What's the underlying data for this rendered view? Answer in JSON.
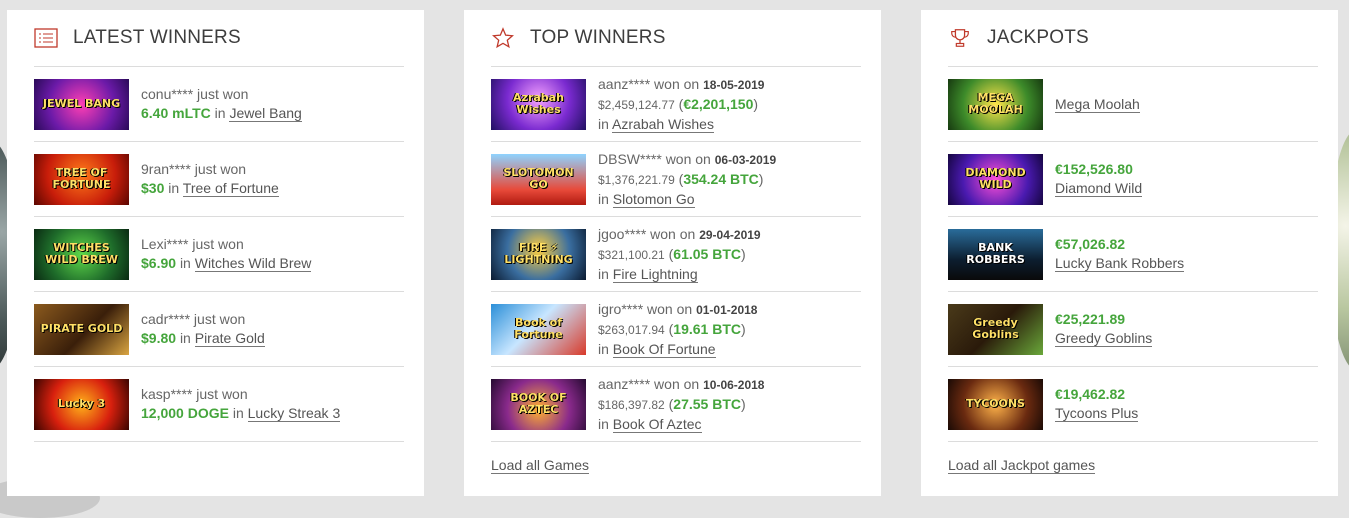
{
  "latest": {
    "title": "LATEST WINNERS",
    "rows": [
      {
        "user": "conu****",
        "just_won": "just won",
        "amount": "6.40 mLTC",
        "in": "in",
        "game": "Jewel Bang",
        "art": "JEWEL BANG"
      },
      {
        "user": "9ran****",
        "just_won": "just won",
        "amount": "$30",
        "in": "in",
        "game": "Tree of Fortune",
        "art": "TREE OF FORTUNE"
      },
      {
        "user": "Lexi****",
        "just_won": "just won",
        "amount": "$6.90",
        "in": "in",
        "game": "Witches Wild Brew",
        "art": "WITCHES WILD BREW"
      },
      {
        "user": "cadr****",
        "just_won": "just won",
        "amount": "$9.80",
        "in": "in",
        "game": "Pirate Gold",
        "art": "PIRATE GOLD"
      },
      {
        "user": "kasp****",
        "just_won": "just won",
        "amount": "12,000 DOGE",
        "in": "in",
        "game": "Lucky Streak 3",
        "art": "Lucky 3"
      }
    ]
  },
  "top": {
    "title": "TOP WINNERS",
    "rows": [
      {
        "user": "aanz****",
        "won_on": "won on",
        "date": "18-05-2019",
        "usd": "$2,459,124.77",
        "open": "(",
        "amount": "€2,201,150",
        "close": ")",
        "in": "in",
        "game": "Azrabah Wishes",
        "art": "Azrabah Wishes"
      },
      {
        "user": "DBSW****",
        "won_on": "won on",
        "date": "06-03-2019",
        "usd": "$1,376,221.79",
        "open": "(",
        "amount": "354.24 BTC",
        "close": ")",
        "in": "in",
        "game": "Slotomon Go",
        "art": "SLOTOMON GO"
      },
      {
        "user": "jgoo****",
        "won_on": "won on",
        "date": "29-04-2019",
        "usd": "$321,100.21",
        "open": "(",
        "amount": "61.05 BTC",
        "close": ")",
        "in": "in",
        "game": "Fire Lightning",
        "art": "FIRE ⚡ LIGHTNING"
      },
      {
        "user": "igro****",
        "won_on": "won on",
        "date": "01-01-2018",
        "usd": "$263,017.94",
        "open": "(",
        "amount": "19.61 BTC",
        "close": ")",
        "in": "in",
        "game": "Book Of Fortune",
        "art": "Book of Fortune"
      },
      {
        "user": "aanz****",
        "won_on": "won on",
        "date": "10-06-2018",
        "usd": "$186,397.82",
        "open": "(",
        "amount": "27.55 BTC",
        "close": ")",
        "in": "in",
        "game": "Book Of Aztec",
        "art": "BOOK OF AZTEC"
      }
    ],
    "load_label": "Load all Games"
  },
  "jackpots": {
    "title": "JACKPOTS",
    "rows": [
      {
        "amount": "",
        "game": "Mega Moolah",
        "art": "MEGA MOOLAH"
      },
      {
        "amount": "€152,526.80",
        "game": "Diamond Wild",
        "art": "DIAMOND WILD"
      },
      {
        "amount": "€57,026.82",
        "game": "Lucky Bank Robbers",
        "art": "BANK ROBBERS"
      },
      {
        "amount": "€25,221.89",
        "game": "Greedy Goblins",
        "art": "Greedy Goblins"
      },
      {
        "amount": "€19,462.82",
        "game": "Tycoons Plus",
        "art": "TYCOONS"
      }
    ],
    "load_label": "Load all Jackpot games"
  },
  "colors": {
    "accent_red": "#c0392b",
    "win_green": "#45a53c"
  },
  "icons": {
    "latest": "list-icon",
    "top": "star-icon",
    "jackpots": "trophy-icon"
  }
}
